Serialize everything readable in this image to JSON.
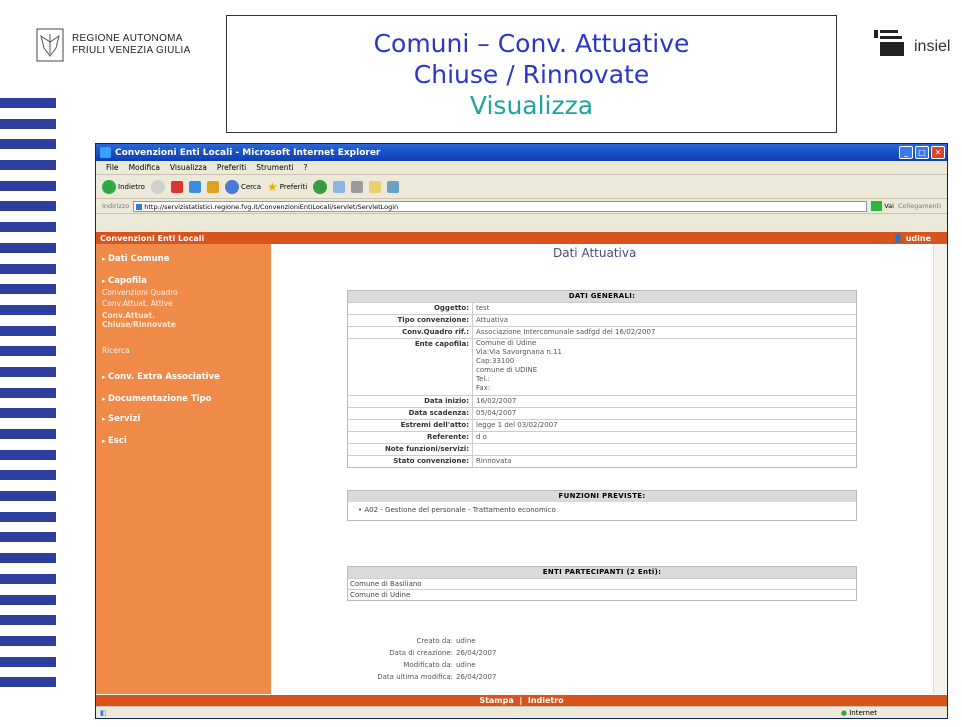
{
  "slide": {
    "org_line1": "REGIONE AUTONOMA",
    "org_line2": "FRIULI VENEZIA GIULIA",
    "title_line1": "Comuni – Conv. Attuative",
    "title_line2": "Chiuse / Rinnovate",
    "title_line3": "Visualizza",
    "brand": "insiel"
  },
  "browser": {
    "window_title": "Convenzioni Enti Locali - Microsoft Internet Explorer",
    "menu": [
      "File",
      "Modifica",
      "Visualizza",
      "Preferiti",
      "Strumenti",
      "?"
    ],
    "toolbar": {
      "back": "Indietro",
      "search": "Cerca",
      "favorites": "Preferiti"
    },
    "address_label": "Indirizzo",
    "address": "http://servizistatistici.regione.fvg.it/ConvenzioniEntiLocali/servlet/ServletLogin",
    "go": "Vai",
    "links": "Collegamenti",
    "status": "Internet"
  },
  "app": {
    "header": "Convenzioni Enti Locali",
    "user": "udine",
    "nav": {
      "dati_comune": "Dati Comune",
      "capofila": "Capofila",
      "conv_quadro": "Convenzioni Quadro",
      "conv_attive": "Conv.Attuat. Attive",
      "conv_chiuse_1": "Conv.Attuat.",
      "conv_chiuse_2": "Chiuse/Rinnovate",
      "ricerca": "Ricerca",
      "extra": "Conv. Extra Associative",
      "doc_tipo": "Documentazione Tipo",
      "servizi": "Servizi",
      "esci": "Esci"
    },
    "page_title": "Dati Attuativa",
    "dati_generali": {
      "header": "DATI GENERALI:",
      "oggetto_k": "Oggetto:",
      "oggetto_v": "test",
      "tipo_k": "Tipo convenzione:",
      "tipo_v": "Attuativa",
      "quadro_k": "Conv.Quadro rif.:",
      "quadro_v": "Associazione Intercomunale sadfgd del 16/02/2007",
      "ente_k": "Ente capofila:",
      "ente_v": "Comune di Udine\nVia:Via Savorgnana n.11\nCap:33100\ncomune di UDINE\nTel.:\nFax:",
      "inizio_k": "Data inizio:",
      "inizio_v": "16/02/2007",
      "scadenza_k": "Data scadenza:",
      "scadenza_v": "05/04/2007",
      "estremi_k": "Estremi dell'atto:",
      "estremi_v": "legge 1 del 03/02/2007",
      "referente_k": "Referente:",
      "referente_v": "d o",
      "note_k": "Note funzioni/servizi:",
      "note_v": "",
      "stato_k": "Stato convenzione:",
      "stato_v": "Rinnovata"
    },
    "funzioni": {
      "header": "FUNZIONI PREVISTE:",
      "item": "A02 - Gestione del personale - Trattamento economico"
    },
    "enti": {
      "header": "ENTI PARTECIPANTI (2 Enti):",
      "e1": "Comune di Basiliano",
      "e2": "Comune di Udine"
    },
    "meta": {
      "creato_k": "Creato da:",
      "creato_v": "udine",
      "data_cr_k": "Data di creazione:",
      "data_cr_v": "26/04/2007",
      "mod_k": "Modificato da:",
      "mod_v": "udine",
      "data_mod_k": "Data ultima modifica:",
      "data_mod_v": "26/04/2007"
    },
    "footer": {
      "stampa": "Stampa",
      "sep": "|",
      "indietro": "Indietro"
    }
  }
}
